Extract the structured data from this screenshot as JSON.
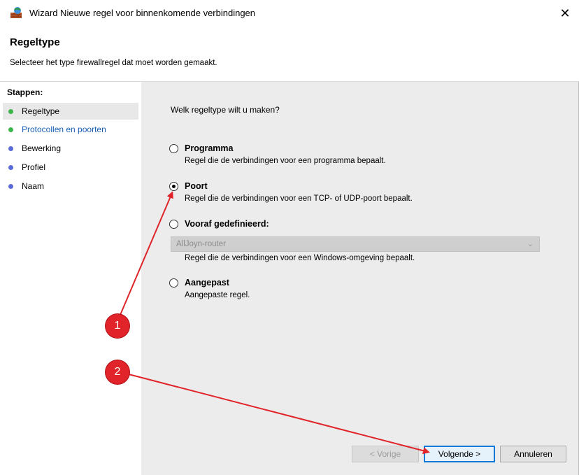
{
  "window": {
    "title": "Wizard Nieuwe regel voor binnenkomende verbindingen",
    "close_glyph": "✕"
  },
  "header": {
    "title": "Regeltype",
    "subtitle": "Selecteer het type firewallregel dat moet worden gemaakt."
  },
  "steps": {
    "title": "Stappen:",
    "items": [
      {
        "label": "Regeltype",
        "dot_color": "#3cb44b"
      },
      {
        "label": "Protocollen en poorten",
        "dot_color": "#3cb44b"
      },
      {
        "label": "Bewerking",
        "dot_color": "#5a6ad6"
      },
      {
        "label": "Profiel",
        "dot_color": "#5a6ad6"
      },
      {
        "label": "Naam",
        "dot_color": "#5a6ad6"
      }
    ]
  },
  "main": {
    "question": "Welk regeltype wilt u maken?",
    "options": [
      {
        "label": "Programma",
        "desc": "Regel die de verbindingen voor een programma bepaalt.",
        "selected": false
      },
      {
        "label": "Poort",
        "desc": "Regel die de verbindingen voor een TCP- of UDP-poort bepaalt.",
        "selected": true
      },
      {
        "label": "Vooraf gedefinieerd:",
        "desc": "Regel die de verbindingen voor een Windows-omgeving bepaalt.",
        "selected": false
      },
      {
        "label": "Aangepast",
        "desc": "Aangepaste regel.",
        "selected": false
      }
    ],
    "dropdown_value": "AllJoyn-router"
  },
  "buttons": {
    "back": "< Vorige",
    "next": "Volgende >",
    "cancel": "Annuleren"
  },
  "annotations": {
    "badge1": "1",
    "badge2": "2",
    "color": "#e0242a"
  }
}
